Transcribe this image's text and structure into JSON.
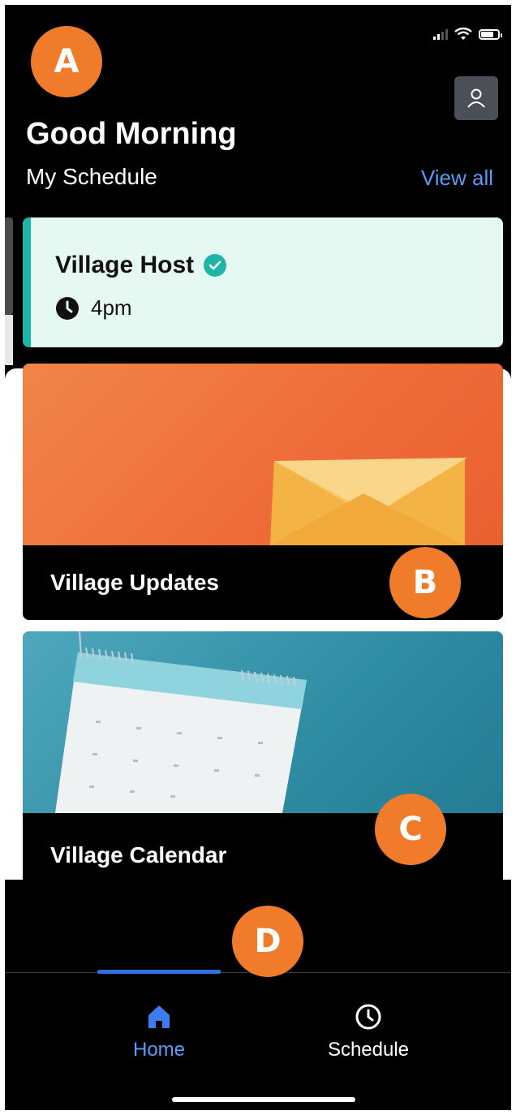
{
  "header": {
    "greeting": "Good Morning",
    "schedule_label": "My Schedule",
    "view_all": "View all"
  },
  "schedule_card": {
    "title": "Village Host",
    "time": "4pm",
    "accent_color": "#1fb5a6"
  },
  "tiles": [
    {
      "label": "Village Updates",
      "icon": "envelope-icon"
    },
    {
      "label": "Village Calendar",
      "icon": "calendar-icon"
    }
  ],
  "nav": {
    "home": "Home",
    "schedule": "Schedule",
    "active": "home",
    "active_color": "#2f6fde"
  },
  "annotations": [
    "A",
    "B",
    "C",
    "D"
  ],
  "colors": {
    "badge": "#f07c2b",
    "link": "#5b9bf5"
  }
}
